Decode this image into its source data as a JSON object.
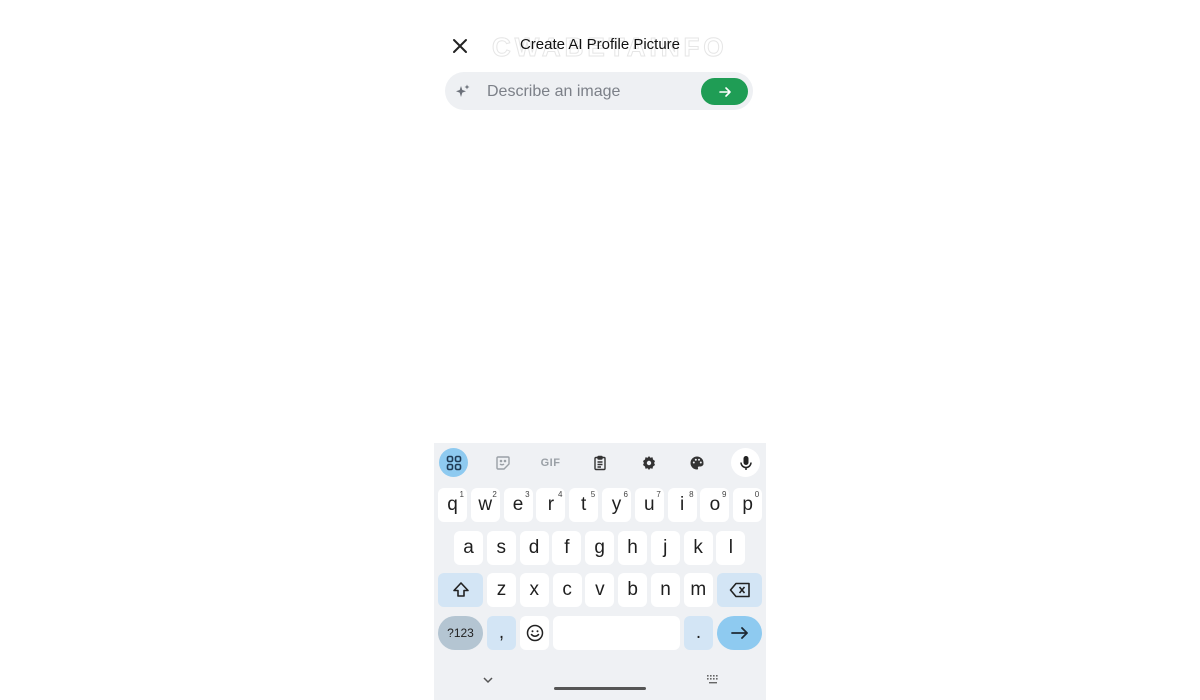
{
  "header": {
    "title": "Create AI Profile Picture",
    "watermark": "CWABETAINFO",
    "close_icon": "close-icon"
  },
  "prompt": {
    "placeholder": "Describe an image",
    "value": "",
    "leading_icon": "sparkle-icon",
    "send_icon": "arrow-right-icon",
    "send_color": "#1f9d55"
  },
  "keyboard": {
    "toolbar": [
      {
        "name": "apps-grid-icon",
        "active": true
      },
      {
        "name": "sticker-icon"
      },
      {
        "name": "gif-icon",
        "label": "GIF"
      },
      {
        "name": "clipboard-icon"
      },
      {
        "name": "settings-icon"
      },
      {
        "name": "palette-icon"
      },
      {
        "name": "microphone-icon"
      }
    ],
    "row1": [
      {
        "k": "q",
        "n": "1"
      },
      {
        "k": "w",
        "n": "2"
      },
      {
        "k": "e",
        "n": "3"
      },
      {
        "k": "r",
        "n": "4"
      },
      {
        "k": "t",
        "n": "5"
      },
      {
        "k": "y",
        "n": "6"
      },
      {
        "k": "u",
        "n": "7"
      },
      {
        "k": "i",
        "n": "8"
      },
      {
        "k": "o",
        "n": "9"
      },
      {
        "k": "p",
        "n": "0"
      }
    ],
    "row2": [
      "a",
      "s",
      "d",
      "f",
      "g",
      "h",
      "j",
      "k",
      "l"
    ],
    "row3": [
      "z",
      "x",
      "c",
      "v",
      "b",
      "n",
      "m"
    ],
    "symbols_label": "?123",
    "comma_label": ",",
    "period_label": ".",
    "accent_color": "#8ecaf0"
  }
}
